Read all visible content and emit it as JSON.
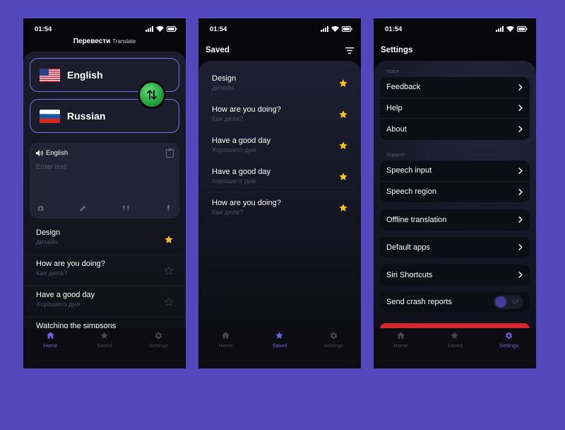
{
  "status": {
    "time": "01:54"
  },
  "tabs": [
    {
      "label": "Home",
      "icon": "home-icon"
    },
    {
      "label": "Saved",
      "icon": "star-icon"
    },
    {
      "label": "Settings",
      "icon": "gear-icon"
    }
  ],
  "colors": {
    "accent": "#6d62e6",
    "star": "#f5c518",
    "background": "#5248bb",
    "danger": "#d9262c"
  },
  "home": {
    "title": "Перевести",
    "title_sub": "Translate",
    "source_lang": "English",
    "target_lang": "Russian",
    "input_lang_label": "English",
    "input_placeholder": "Enter text",
    "history": [
      {
        "en": "Design",
        "ru": "дизайн",
        "starred": true
      },
      {
        "en": "How are you doing?",
        "ru": "Как дела?",
        "starred": false
      },
      {
        "en": "Have a good day",
        "ru": "Хорошего дня",
        "starred": false
      },
      {
        "en": "Watching the simpsons",
        "ru": "",
        "starred": false
      }
    ]
  },
  "saved": {
    "title": "Saved",
    "items": [
      {
        "en": "Design",
        "ru": "дизайн"
      },
      {
        "en": "How are you doing?",
        "ru": "Как дела?"
      },
      {
        "en": "Have a good day",
        "ru": "Хорошего дня"
      },
      {
        "en": "Have a good day",
        "ru": "Хорошего дня"
      },
      {
        "en": "How are you doing?",
        "ru": "Как дела?"
      }
    ]
  },
  "settings": {
    "title": "Settings",
    "voice_label": "Voice",
    "voice_items": [
      "Feedback",
      "Help",
      "About"
    ],
    "support_label": "Support",
    "support_items": [
      "Speech input",
      "Speech region"
    ],
    "offline": "Offline translation",
    "default_apps": "Default apps",
    "siri": "Siri Shortcuts",
    "crash_reports": "Send crash reports",
    "toggle_state": "Off"
  }
}
